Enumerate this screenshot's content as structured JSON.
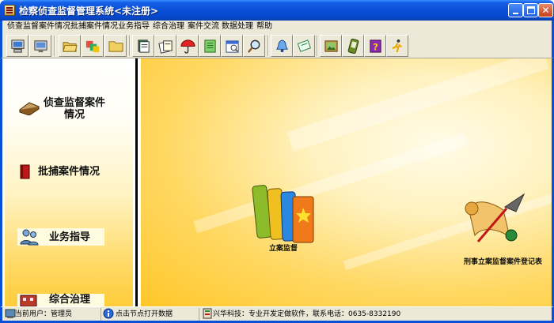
{
  "window": {
    "title": "检察侦查监督管理系统<未注册>"
  },
  "menu": [
    "侦查监督案件情况",
    "批捕案件情况",
    "业务指导",
    "综合治理",
    "案件交流",
    "数据处理",
    "帮助"
  ],
  "toolbar": {
    "icons": [
      "computer-icon",
      "monitor-icon",
      "open-folder-icon",
      "transfer-icon",
      "folder-icon",
      "documents-icon",
      "papers-icon",
      "umbrella-icon",
      "notebook-icon",
      "calendar-icon",
      "find-icon",
      "search-icon",
      "bell-icon",
      "note-icon",
      "picture-icon",
      "pda-icon",
      "help-book-icon",
      "exit-icon"
    ]
  },
  "nav": {
    "case_status": "侦查监督案件情况",
    "arrest": "批捕案件情况",
    "guidance": "业务指导",
    "governance": "综合治理"
  },
  "desktop": {
    "filing_supervision": "立案监督",
    "criminal_register": "刑事立案监督案件登记表"
  },
  "status": {
    "user": "当前用户：管理员",
    "hint": "点击节点打开数据",
    "company": "兴华科技：专业开发定做软件，联系电话：0635-8332190"
  },
  "colors": {
    "titlebar": "#0a4fd8",
    "chrome": "#ece9d8",
    "background_yellow": "#ffcc3a"
  }
}
